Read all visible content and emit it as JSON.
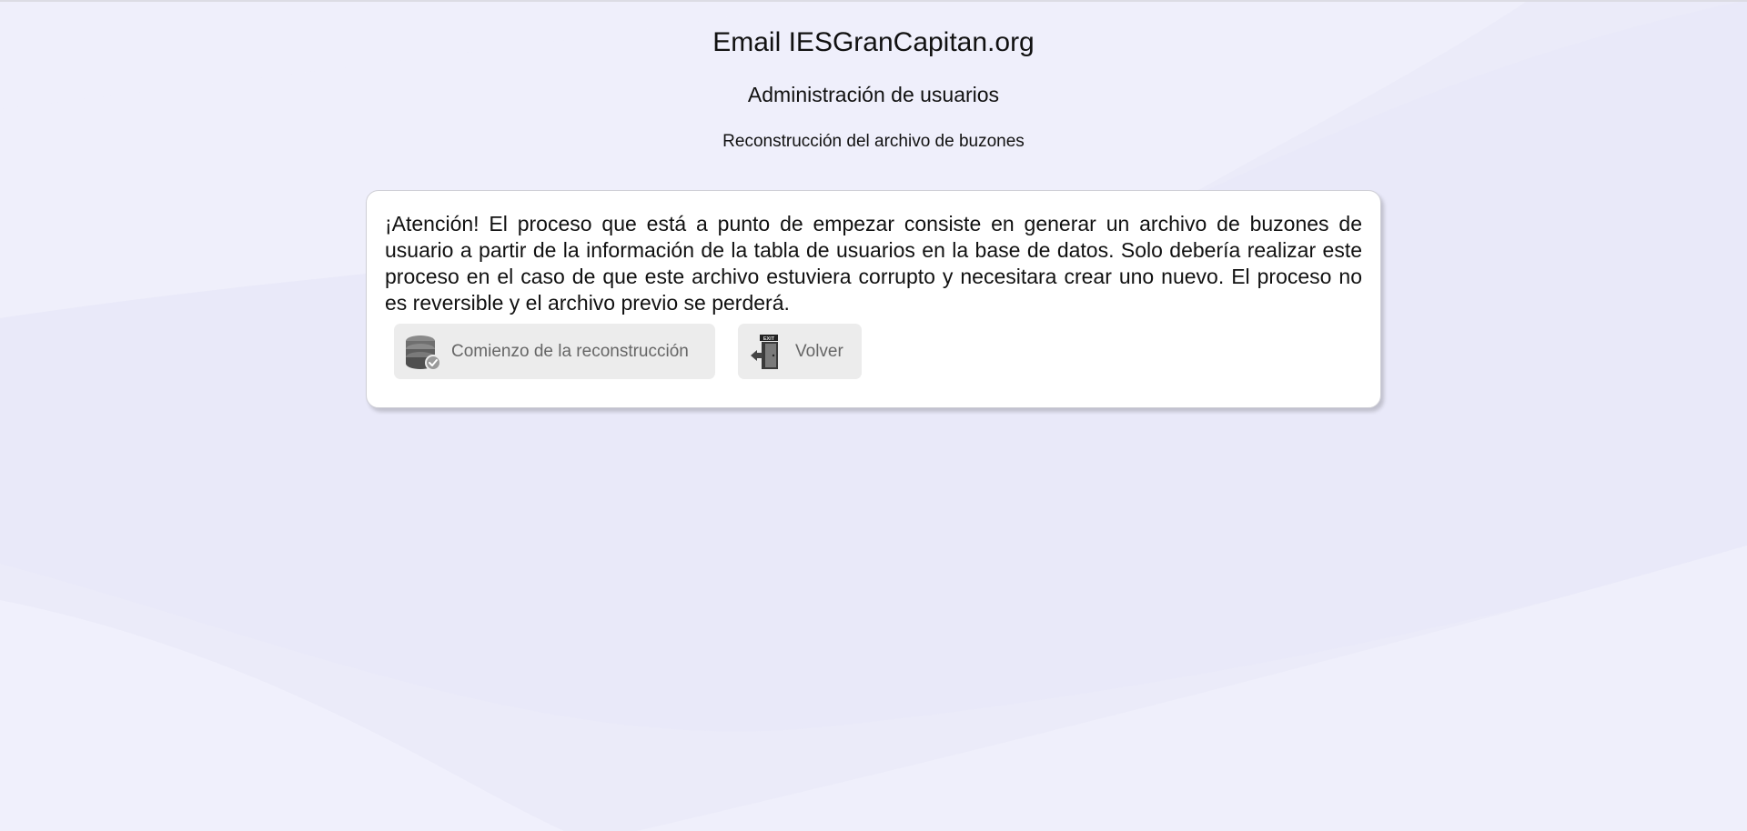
{
  "header": {
    "title": "Email IESGranCapitan.org",
    "subtitle": "Administración de usuarios",
    "section": "Reconstrucción del archivo de buzones"
  },
  "card": {
    "warning_text": "¡Atención! El proceso que está a punto de empezar consiste en generar un archivo de buzones de usuario a partir de la información de la tabla de usuarios en la base de datos. Solo debería realizar este proceso en el caso de que este archivo estuviera corrupto y necesitara crear uno nuevo. El proceso no es reversible y el archivo previo se perderá.",
    "buttons": [
      {
        "label": "Comienzo de la reconstrucción",
        "icon": "database-check-icon"
      },
      {
        "label": "Volver",
        "icon": "exit-door-icon"
      }
    ]
  },
  "colors": {
    "background": "#ebebf9",
    "card_background": "#ffffff",
    "button_background": "#ececec",
    "button_text": "#666666"
  }
}
